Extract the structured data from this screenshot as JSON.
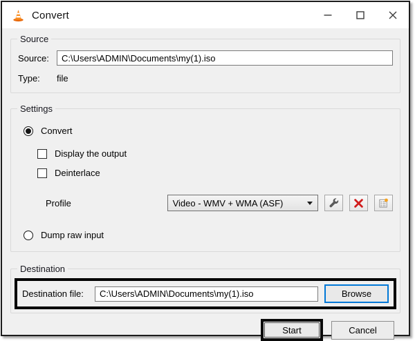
{
  "window": {
    "title": "Convert"
  },
  "source": {
    "group_label": "Source",
    "field_label": "Source:",
    "field_value": "C:\\Users\\ADMIN\\Documents\\my(1).iso",
    "type_label": "Type:",
    "type_value": "file"
  },
  "settings": {
    "group_label": "Settings",
    "convert": {
      "label": "Convert",
      "selected": true
    },
    "display_output": {
      "label": "Display the output",
      "checked": false
    },
    "deinterlace": {
      "label": "Deinterlace",
      "checked": false
    },
    "profile": {
      "label": "Profile",
      "selected_value": "Video - WMV + WMA (ASF)"
    },
    "dump_raw_input": {
      "label": "Dump raw input",
      "selected": false
    }
  },
  "destination": {
    "group_label": "Destination",
    "field_label": "Destination file:",
    "field_value": "C:\\Users\\ADMIN\\Documents\\my(1).iso",
    "browse_label": "Browse"
  },
  "actions": {
    "start_label": "Start",
    "cancel_label": "Cancel"
  },
  "icons": {
    "app_icon": "vlc-cone",
    "profile_edit": "wrench-icon",
    "profile_delete": "red-x-icon",
    "profile_new": "new-profile-list-icon"
  },
  "colors": {
    "dialog_background": "#f0f0f0",
    "titlebar_background": "#ffffff",
    "browse_focus_border": "#0078d7",
    "delete_x_red": "#d11c1c",
    "vlc_orange": "#f98b1e",
    "annotation_highlight": "#000000"
  }
}
